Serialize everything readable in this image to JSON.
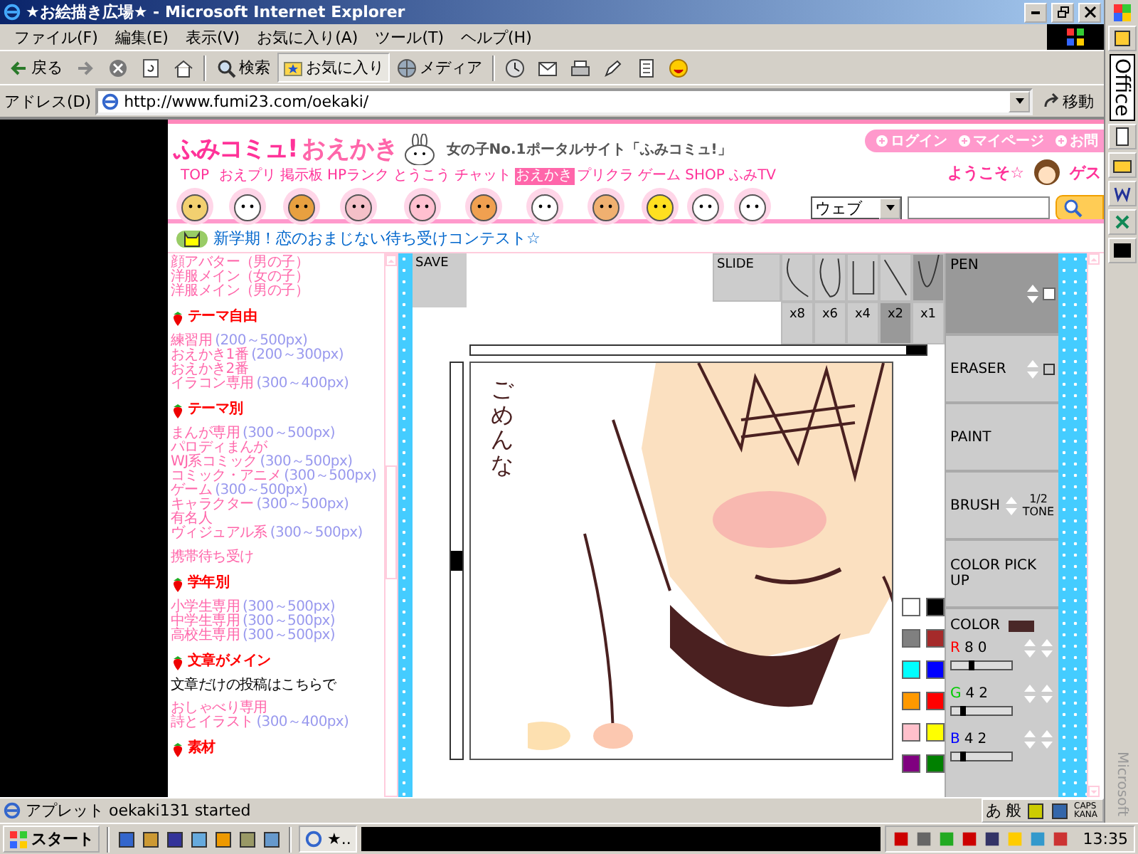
{
  "window": {
    "title": "★お絵描き広場★ - Microsoft Internet Explorer"
  },
  "menu": [
    "ファイル(F)",
    "編集(E)",
    "表示(V)",
    "お気に入り(A)",
    "ツール(T)",
    "ヘルプ(H)"
  ],
  "toolbar": [
    {
      "kind": "back",
      "label": "戻る",
      "selected": false
    },
    {
      "kind": "forward",
      "selected": false
    },
    {
      "kind": "stop",
      "selected": false
    },
    {
      "kind": "refresh",
      "selected": false
    },
    {
      "kind": "home",
      "selected": false
    },
    {
      "kind": "search",
      "label": "検索",
      "selected": false
    },
    {
      "kind": "favorites",
      "label": "お気に入り",
      "selected": true
    },
    {
      "kind": "media",
      "label": "メディア",
      "selected": false
    },
    {
      "kind": "history",
      "selected": false
    },
    {
      "kind": "mail",
      "selected": false
    },
    {
      "kind": "print",
      "selected": false
    },
    {
      "kind": "edit",
      "selected": false
    },
    {
      "kind": "discuss",
      "selected": false
    },
    {
      "kind": "messenger",
      "selected": false
    }
  ],
  "address": {
    "label": "アドレス(D)",
    "url": "http://www.fumi23.com/oekaki/",
    "go": "移動"
  },
  "office_bar": {
    "title": "Office",
    "footer": "Microsoft"
  },
  "site": {
    "logo": "ふみコミュ!",
    "section": "おえかき",
    "tagline": "女の子No.1ポータルサイト「ふみコミュ!」",
    "account_links": [
      "ログイン",
      "マイページ",
      "お問"
    ],
    "welcome": "ようこそ☆",
    "user": "ゲス",
    "nav": [
      {
        "label": "TOP",
        "selected": false
      },
      {
        "label": "おえプリ",
        "selected": false
      },
      {
        "label": "掲示板",
        "selected": false
      },
      {
        "label": "HPランク",
        "selected": false
      },
      {
        "label": "とうこう",
        "selected": false
      },
      {
        "label": "チャット",
        "selected": false
      },
      {
        "label": "おえかき",
        "selected": true
      },
      {
        "label": "プリクラ",
        "selected": false
      },
      {
        "label": "ゲーム",
        "selected": false
      },
      {
        "label": "SHOP",
        "selected": false
      },
      {
        "label": "ふみTV",
        "selected": false
      }
    ],
    "search": {
      "scope": "ウェブ"
    },
    "news": "新学期！恋のおまじない待ち受けコンテスト☆"
  },
  "sidebar": [
    {
      "links": [
        {
          "name": "顔アバター（男の子）"
        },
        {
          "name": "洋服メイン（女の子）"
        },
        {
          "name": "洋服メイン（男の子）"
        }
      ]
    },
    {
      "heading": "テーマ自由",
      "links": [
        {
          "name": "練習用",
          "size": "(200～500px)"
        },
        {
          "name": "おえかき1番",
          "size": "(200～300px)"
        },
        {
          "name": "おえかき2番"
        },
        {
          "name": "イラコン専用",
          "size": "(300～400px)"
        }
      ]
    },
    {
      "heading": "テーマ別",
      "links": [
        {
          "name": "まんが専用",
          "size": "(300～500px)"
        },
        {
          "name": "パロディまんが"
        },
        {
          "name": "WJ系コミック",
          "size": "(300～500px)"
        },
        {
          "name": "コミック・アニメ",
          "size": "(300～500px)"
        },
        {
          "name": "ゲーム",
          "size": "(300～500px)"
        },
        {
          "name": "キャラクター",
          "size": "(300～500px)"
        },
        {
          "name": "有名人"
        },
        {
          "name": "ヴィジュアル系",
          "size": "(300～500px)"
        }
      ]
    },
    {
      "links": [
        {
          "name": "携帯待ち受け"
        }
      ]
    },
    {
      "heading": "学年別",
      "links": [
        {
          "name": "小学生専用",
          "size": "(300～500px)"
        },
        {
          "name": "中学生専用",
          "size": "(300～500px)"
        },
        {
          "name": "高校生専用",
          "size": "(300～500px)"
        }
      ]
    },
    {
      "heading": "文章がメイン",
      "note": "文章だけの投稿はこちらで",
      "links": [
        {
          "name": "おしゃべり専用"
        },
        {
          "name": "詩とイラスト",
          "size": "(300～400px)"
        }
      ]
    },
    {
      "heading": "素材"
    }
  ],
  "applet": {
    "save": "SAVE",
    "slide": "SLIDE",
    "curves": [
      {
        "selected": false
      },
      {
        "selected": false
      },
      {
        "selected": false
      },
      {
        "selected": false
      },
      {
        "selected": true
      }
    ],
    "zoom": [
      {
        "label": "x8",
        "selected": false
      },
      {
        "label": "x6",
        "selected": false
      },
      {
        "label": "x4",
        "selected": false
      },
      {
        "label": "x2",
        "selected": true
      },
      {
        "label": "x1",
        "selected": false
      }
    ],
    "handwriting": "ごめんな",
    "palette": [
      {
        "color": "#ffffff"
      },
      {
        "color": "#000000"
      },
      {
        "color": "#808080"
      },
      {
        "color": "#a52a2a"
      },
      {
        "color": "#00ffff"
      },
      {
        "color": "#0000ff"
      },
      {
        "color": "#ff9900"
      },
      {
        "color": "#ff0000"
      },
      {
        "color": "#ffc0cb"
      },
      {
        "color": "#ffff00"
      },
      {
        "color": "#800080"
      },
      {
        "color": "#008000"
      }
    ],
    "tools": [
      {
        "kind": "size",
        "label": "PEN",
        "selected": true
      },
      {
        "kind": "size",
        "label": "ERASER",
        "selected": false
      },
      {
        "kind": "plain",
        "label": "PAINT",
        "selected": false
      },
      {
        "kind": "tone",
        "label": "BRUSH",
        "option": "1/2 TONE",
        "selected": false
      },
      {
        "kind": "plain",
        "label": "COLOR PICK UP",
        "selected": false
      }
    ],
    "color": {
      "label": "COLOR",
      "swatch": {
        "color": "#4a2828"
      },
      "channels": [
        {
          "name": "R",
          "value": "80",
          "color": "#ff0000",
          "level": 0.31
        },
        {
          "name": "G",
          "value": "42",
          "color": "#00cc00",
          "level": 0.16
        },
        {
          "name": "B",
          "value": "42",
          "color": "#0000ff",
          "level": 0.16
        }
      ]
    }
  },
  "status_bar": {
    "text": "アプレット oekaki131 started"
  },
  "language_bar": {
    "ime": [
      "あ",
      "般"
    ],
    "keys": [
      "CAPS",
      "KANA"
    ]
  },
  "taskbar": {
    "start": "スタート",
    "task": "★..",
    "clock": "13:35"
  }
}
